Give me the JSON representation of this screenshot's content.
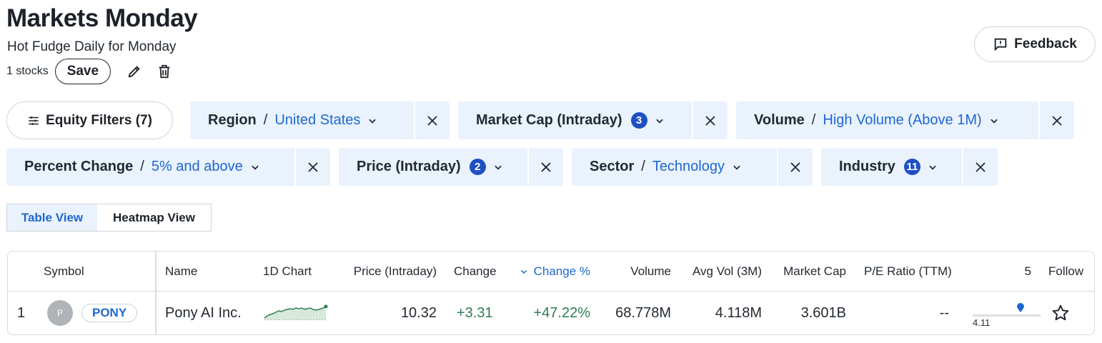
{
  "header": {
    "title": "Markets Monday",
    "subtitle": "Hot Fudge Daily for Monday",
    "stock_count": "1 stocks",
    "save_label": "Save",
    "feedback_label": "Feedback"
  },
  "filters": {
    "equity_label": "Equity Filters (7)",
    "chips": [
      {
        "label": "Region",
        "separator": "/",
        "value": "United States"
      },
      {
        "label": "Market Cap (Intraday)",
        "badge": "3"
      },
      {
        "label": "Volume",
        "separator": "/",
        "value": "High Volume (Above 1M)"
      },
      {
        "label": "Percent Change",
        "separator": "/",
        "value": "5% and above"
      },
      {
        "label": "Price (Intraday)",
        "badge": "2"
      },
      {
        "label": "Sector",
        "separator": "/",
        "value": "Technology"
      },
      {
        "label": "Industry",
        "badge": "11"
      }
    ]
  },
  "views": {
    "table": "Table View",
    "heatmap": "Heatmap View"
  },
  "table": {
    "columns": {
      "symbol": "Symbol",
      "name": "Name",
      "chart": "1D Chart",
      "price": "Price (Intraday)",
      "change": "Change",
      "change_pct": "Change %",
      "volume": "Volume",
      "avg_vol": "Avg Vol (3M)",
      "market_cap": "Market Cap",
      "pe": "P/E Ratio (TTM)",
      "range": "5",
      "follow": "Follow"
    },
    "rows": [
      {
        "index": "1",
        "avatar": "P",
        "symbol": "PONY",
        "name": "Pony AI Inc.",
        "price": "10.32",
        "change": "+3.31",
        "change_pct": "+47.22%",
        "volume": "68.778M",
        "avg_vol": "4.118M",
        "market_cap": "3.601B",
        "pe": "--",
        "range_low": "4.11",
        "range_position": 0.7
      }
    ]
  },
  "colors": {
    "accent": "#1f67d1",
    "chip_bg": "#e9f2fd",
    "badge": "#1f4fc4",
    "positive": "#2e7d4f"
  }
}
